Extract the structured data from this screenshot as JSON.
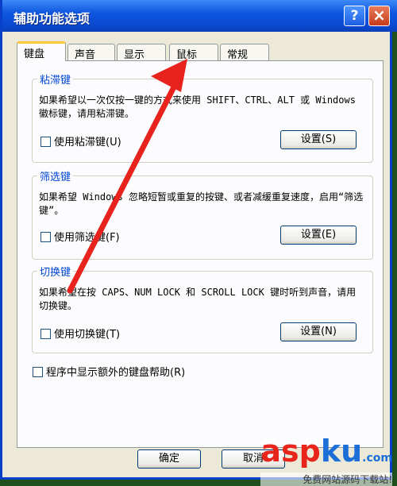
{
  "window": {
    "title": "辅助功能选项",
    "help_label": "?",
    "close_label": "×"
  },
  "tabs": [
    {
      "label": "键盘",
      "active": true
    },
    {
      "label": "声音",
      "active": false
    },
    {
      "label": "显示",
      "active": false
    },
    {
      "label": "鼠标",
      "active": false
    },
    {
      "label": "常规",
      "active": false
    }
  ],
  "groups": {
    "sticky": {
      "title": "粘滞键",
      "description": "如果希望以一次仅按一键的方式来使用 SHIFT、CTRL、ALT 或 Windows 徽标键，请用粘滞键。",
      "checkbox_label": "使用粘滞键(U)",
      "checked": false,
      "button_label": "设置(S)"
    },
    "filter": {
      "title": "筛选键",
      "description": "如果希望 Windows 忽略短暂或重复的按键、或者减缓重复速度，启用“筛选键”。",
      "checkbox_label": "使用筛选键(F)",
      "checked": false,
      "button_label": "设置(E)"
    },
    "toggle": {
      "title": "切换键",
      "description": "如果希望在按 CAPS、NUM LOCK 和 SCROLL LOCK 键时听到声音，请用切换键。",
      "checkbox_label": "使用切换键(T)",
      "checked": false,
      "button_label": "设置(N)"
    }
  },
  "extra_help": {
    "label": "程序中显示额外的键盘帮助(R)",
    "checked": false
  },
  "footer": {
    "ok_label": "确定",
    "cancel_label": "取消"
  },
  "watermark": {
    "brand_part1": "asp",
    "brand_part2": "ku",
    "brand_suffix": ".com",
    "subtitle": "免费网站源码下载站!"
  },
  "colors": {
    "titlebar": "#0a49d0",
    "group_title": "#0046d5",
    "arrow": "#e8231d",
    "tab_highlight": "#ffc83c"
  }
}
